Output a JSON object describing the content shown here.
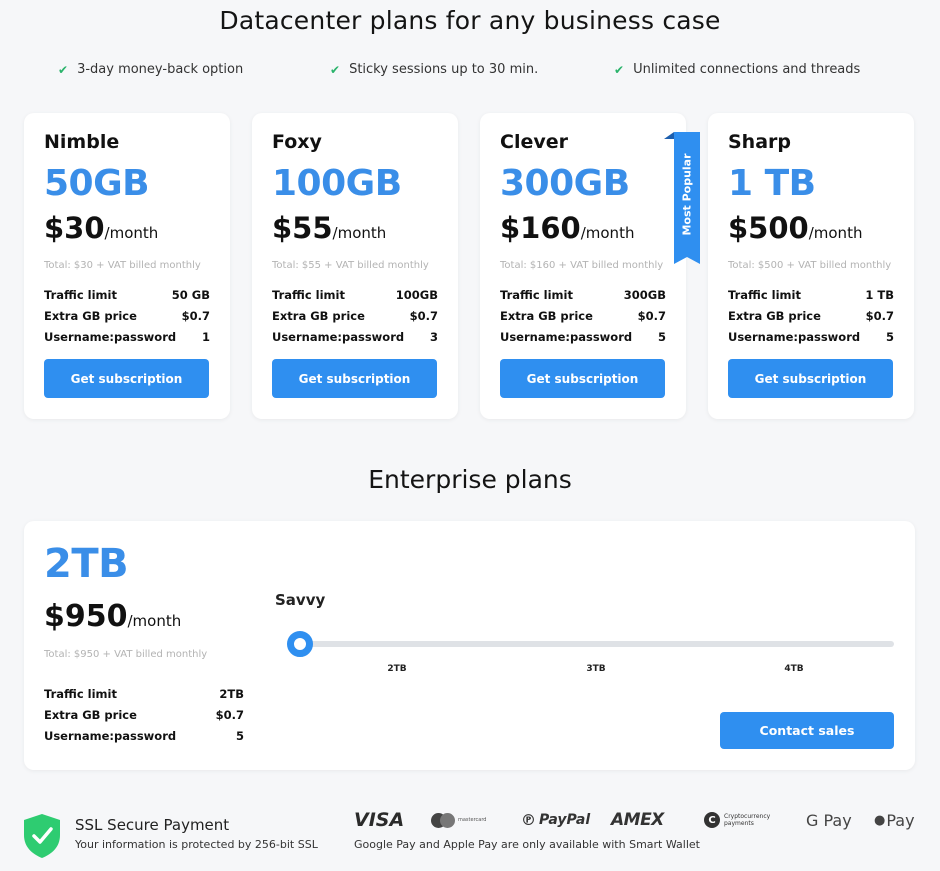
{
  "page": {
    "title": "Datacenter plans for any business case",
    "features": [
      {
        "icon": "check-icon",
        "text": "3-day money-back option"
      },
      {
        "icon": "check-icon",
        "text": "Sticky sessions up to 30 min."
      },
      {
        "icon": "check-icon",
        "text": "Unlimited connections and threads"
      }
    ]
  },
  "plans": [
    {
      "name": "Nimble",
      "size": "50GB",
      "price": "$30",
      "per": "/month",
      "total": "Total: $30 + VAT billed monthly",
      "specs": [
        {
          "label": "Traffic limit",
          "value": "50 GB"
        },
        {
          "label": "Extra GB price",
          "value": "$0.7"
        },
        {
          "label": "Username:password",
          "value": "1"
        }
      ],
      "button": "Get subscription"
    },
    {
      "name": "Foxy",
      "size": "100GB",
      "price": "$55",
      "per": "/month",
      "total": "Total: $55 + VAT billed monthly",
      "specs": [
        {
          "label": "Traffic limit",
          "value": "100GB"
        },
        {
          "label": "Extra GB price",
          "value": "$0.7"
        },
        {
          "label": "Username:password",
          "value": "3"
        }
      ],
      "button": "Get subscription"
    },
    {
      "name": "Clever",
      "size": "300GB",
      "price": "$160",
      "per": "/month",
      "total": "Total: $160 + VAT billed monthly",
      "specs": [
        {
          "label": "Traffic limit",
          "value": "300GB"
        },
        {
          "label": "Extra GB price",
          "value": "$0.7"
        },
        {
          "label": "Username:password",
          "value": "5"
        }
      ],
      "button": "Get subscription",
      "ribbon": "Most Popular"
    },
    {
      "name": "Sharp",
      "size": "1 TB",
      "price": "$500",
      "per": "/month",
      "total": "Total: $500 + VAT billed monthly",
      "specs": [
        {
          "label": "Traffic limit",
          "value": "1 TB"
        },
        {
          "label": "Extra GB price",
          "value": "$0.7"
        },
        {
          "label": "Username:password",
          "value": "5"
        }
      ],
      "button": "Get subscription"
    }
  ],
  "enterprise": {
    "title": "Enterprise plans",
    "size": "2TB",
    "price": "$950",
    "per": "/month",
    "total": "Total: $950 + VAT billed monthly",
    "specs": [
      {
        "label": "Traffic limit",
        "value": "2TB"
      },
      {
        "label": "Extra GB price",
        "value": "$0.7"
      },
      {
        "label": "Username:password",
        "value": "5"
      }
    ],
    "plan_name": "Savvy",
    "slider": {
      "ticks": [
        "2TB",
        "3TB",
        "4TB"
      ],
      "selected": "2TB"
    },
    "button": "Contact sales"
  },
  "footer": {
    "ssl_title": "SSL Secure Payment",
    "ssl_sub": "Your information is protected by 256-bit SSL",
    "payment_methods": [
      "VISA",
      "mastercard",
      "PayPal",
      "AMEX",
      "Cryptocurrency payments",
      "G Pay",
      "Pay"
    ],
    "note": "Google Pay and Apple Pay are only available with Smart Wallet"
  },
  "colors": {
    "accent": "#2f8ff0",
    "size_text": "#3a8ee8",
    "check": "#2ab36b",
    "shield": "#2ecc71"
  }
}
